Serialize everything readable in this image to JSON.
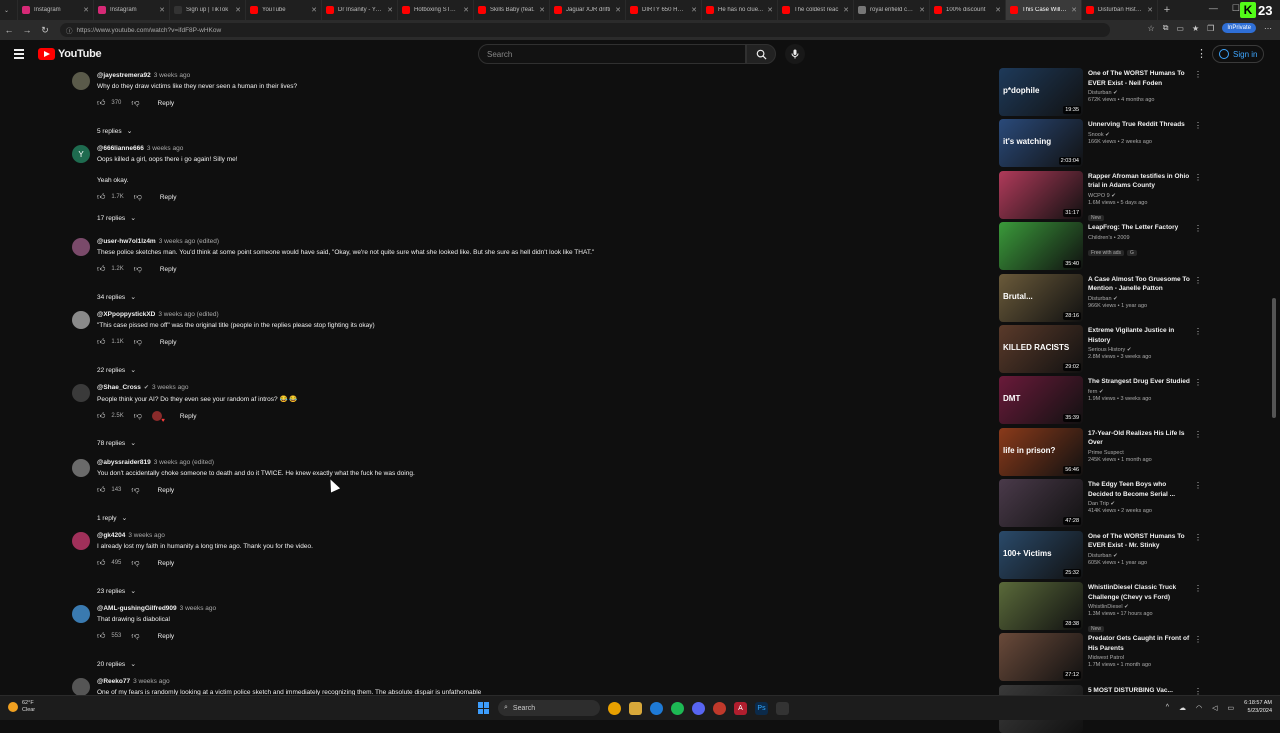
{
  "browser": {
    "tabs": [
      {
        "label": "Instagram",
        "color": "#d62976"
      },
      {
        "label": "Instagram",
        "color": "#d62976"
      },
      {
        "label": "Sign up | TikTok",
        "color": "#333333"
      },
      {
        "label": "YouTube",
        "color": "#ff0000"
      },
      {
        "label": "Dr Insanity - YouT",
        "color": "#ff0000"
      },
      {
        "label": "Hotboxing STARB",
        "color": "#ff0000"
      },
      {
        "label": "Skills Baby (feat.",
        "color": "#ff0000"
      },
      {
        "label": "Jaguar XJR drifti",
        "color": "#ff0000"
      },
      {
        "label": "DIRTY 650 HP Do",
        "color": "#ff0000"
      },
      {
        "label": "He has no clue...",
        "color": "#ff0000"
      },
      {
        "label": "The coldest reac",
        "color": "#ff0000"
      },
      {
        "label": "royal enfield cont",
        "color": "#777777"
      },
      {
        "label": "100% discount",
        "color": "#ff0000"
      },
      {
        "label": "This Case Will Ta",
        "color": "#ff0000"
      },
      {
        "label": "Disturban History",
        "color": "#ff0000"
      }
    ],
    "active_tab_index": 13,
    "url": "https://www.youtube.com/watch?v=ifdF8P-wHKow",
    "inprivate_label": "InPrivate",
    "k_number": "23"
  },
  "youtube": {
    "logo_text": "YouTube",
    "search_placeholder": "Search",
    "signin_label": "Sign in"
  },
  "comments": [
    {
      "handle": "@jayestremera92",
      "time": "3 weeks ago",
      "text": "Why do they draw victims like they never seen a human in their lives?",
      "likes": "370",
      "replies": "5 replies",
      "avatar_color": "#5a5a4a",
      "avatar_letter": ""
    },
    {
      "handle": "@666lianne666",
      "time": "3 weeks ago",
      "text": "Oops killed a girl, oops there i go again! Silly me!",
      "text2": "Yeah okay.",
      "likes": "1.7K",
      "replies": "17 replies",
      "avatar_color": "#1e6b4f",
      "avatar_letter": "Y"
    },
    {
      "handle": "@user-hw7ol1lz4m",
      "time": "3 weeks ago (edited)",
      "text": "These police sketches man. You'd think at some point someone would have said, \"Okay, we're not quite sure what she looked like. But she sure as hell didn't look like THAT.\"",
      "likes": "1.2K",
      "replies": "34 replies",
      "avatar_color": "#7a4a6a",
      "avatar_letter": ""
    },
    {
      "handle": "@XPpoppystickXD",
      "time": "3 weeks ago (edited)",
      "text": "\"This case pissed me off\" was the original title (people in the replies please stop fighting its okay)",
      "likes": "1.1K",
      "replies": "22 replies",
      "avatar_color": "#8a8a8a",
      "avatar_letter": ""
    },
    {
      "handle": "@Shae_Cross",
      "time": "3 weeks ago",
      "text": "People think your AI? Do they even see your random af intros? 😂 😂",
      "likes": "2.5K",
      "replies": "78 replies",
      "avatar_color": "#3a3a3a",
      "avatar_letter": "",
      "verified": "✔"
    },
    {
      "handle": "@abyssraider819",
      "time": "3 weeks ago (edited)",
      "text": "You don't accidentally choke someone to death and do it TWICE. He knew exactly what the fuck he was doing.",
      "likes": "143",
      "replies": "1 reply",
      "avatar_color": "#6a6a6a",
      "avatar_letter": ""
    },
    {
      "handle": "@gk4204",
      "time": "3 weeks ago",
      "text": "I already lost my faith in humanity a long time ago. Thank you for the video.",
      "likes": "495",
      "replies": "23 replies",
      "avatar_color": "#a0305a",
      "avatar_letter": ""
    },
    {
      "handle": "@AML-gushingGilfred909",
      "time": "3 weeks ago",
      "text": "That drawing is diabolical",
      "likes": "553",
      "replies": "20 replies",
      "avatar_color": "#3a7ab0",
      "avatar_letter": ""
    },
    {
      "handle": "@Reeko77",
      "time": "3 weeks ago",
      "text": "One of my fears is randomly looking at a victim police sketch and immediately recognizing them. The absolute dispair is unfathomable",
      "likes": "",
      "replies": "",
      "avatar_color": "#555555",
      "avatar_letter": ""
    }
  ],
  "recommendations": [
    {
      "title": "One of The WORST Humans To EVER Exist - Neil Foden",
      "channel": "Disturban",
      "stats": "672K views • 4 months ago",
      "duration": "19:35",
      "overlay": "p*dophile",
      "thumb_color": "#1e3a5a",
      "verified": true
    },
    {
      "title": "Unnerving True Reddit Threads",
      "channel": "Snook",
      "stats": "166K views • 2 weeks ago",
      "duration": "2:03:04",
      "overlay": "it's watching",
      "thumb_color": "#2a4a7a",
      "verified": true
    },
    {
      "title": "Rapper Afroman testifies in Ohio trial in Adams County",
      "channel": "WCPO 9",
      "stats": "1.6M views • 5 days ago",
      "duration": "31:17",
      "overlay": "",
      "thumb_color": "#b03a5a",
      "verified": true,
      "badge": "New"
    },
    {
      "title": "LeapFrog: The Letter Factory",
      "channel": "Children's • 2009",
      "stats": "",
      "duration": "35:40",
      "overlay": "",
      "thumb_color": "#3a9a3a",
      "verified": false,
      "badge": "Free with ads",
      "badge2": "G"
    },
    {
      "title": "A Case Almost Too Gruesome To Mention - Janelle Patton",
      "channel": "Disturban",
      "stats": "966K views • 1 year ago",
      "duration": "28:16",
      "overlay": "Brutal...",
      "thumb_color": "#6a5a3a",
      "verified": true
    },
    {
      "title": "Extreme Vigilante Justice in History",
      "channel": "Serious History",
      "stats": "2.8M views • 3 weeks ago",
      "duration": "29:02",
      "overlay": "KILLED RACISTS",
      "thumb_color": "#5a3a2a",
      "verified": true
    },
    {
      "title": "The Strangest Drug Ever Studied",
      "channel": "fern",
      "stats": "1.9M views • 3 weeks ago",
      "duration": "35:39",
      "overlay": "DMT",
      "thumb_color": "#6a1a3a",
      "verified": true
    },
    {
      "title": "17-Year-Old Realizes His Life Is Over",
      "channel": "Prime Suspect",
      "stats": "245K views • 1 month ago",
      "duration": "56:46",
      "overlay": "life in prison?",
      "thumb_color": "#8a3a1a",
      "verified": false
    },
    {
      "title": "The Edgy Teen Boys who Decided to Become Serial ...",
      "channel": "Dan Trip",
      "stats": "414K views • 2 weeks ago",
      "duration": "47:28",
      "overlay": "",
      "thumb_color": "#4a3a4a",
      "verified": true
    },
    {
      "title": "One of The WORST Humans To EVER Exist - Mr. Stinky",
      "channel": "Disturban",
      "stats": "605K views • 1 year ago",
      "duration": "25:32",
      "overlay": "100+ Victims",
      "thumb_color": "#2a4a6a",
      "verified": true
    },
    {
      "title": "WhistlinDiesel Classic Truck Challenge (Chevy vs Ford)",
      "channel": "WhistlinDiesel",
      "stats": "1.3M views • 17 hours ago",
      "duration": "28:38",
      "overlay": "",
      "thumb_color": "#5a6a3a",
      "verified": true,
      "badge": "New"
    },
    {
      "title": "Predator Gets Caught in Front of His Parents",
      "channel": "Midwest Patrol",
      "stats": "1.7M views • 1 month ago",
      "duration": "27:12",
      "overlay": "",
      "thumb_color": "#6a4a3a",
      "verified": false
    },
    {
      "title": "5 MOST DISTURBING Vac...",
      "channel": "",
      "stats": "",
      "duration": "",
      "overlay": "",
      "thumb_color": "#3a3a3a",
      "verified": false
    }
  ],
  "taskbar": {
    "temp": "62°F",
    "weather": "Clear",
    "search": "Search",
    "time": "6:18:57 AM",
    "date": "5/23/2024"
  }
}
